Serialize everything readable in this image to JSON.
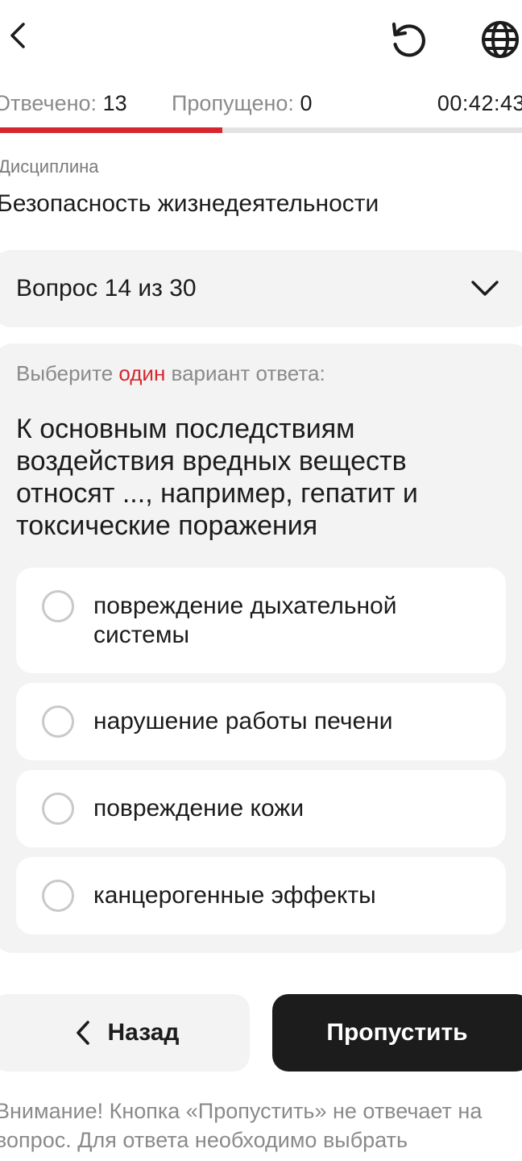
{
  "header": {
    "back_icon": "chevron-left-icon",
    "reset_icon": "reset-icon",
    "language_icon": "globe-icon"
  },
  "stats": {
    "answered_label": "Отвечено:",
    "answered_value": "13",
    "skipped_label": "Пропущено:",
    "skipped_value": "0",
    "timer": "00:42:43"
  },
  "progress": {
    "fraction": 0.4255,
    "fill_color": "#d6262e",
    "track_color": "#e5e2e5"
  },
  "discipline": {
    "label": "Дисциплина",
    "value": "Безопасность жизнедеятельности"
  },
  "question_selector": {
    "label": "Вопрос 14 из 30",
    "icon": "chevron-down-icon"
  },
  "question": {
    "instruction_prefix": "Выберите ",
    "instruction_accent": "один",
    "instruction_suffix": " вариант ответа:",
    "text": "К основным последствиям воздействия вредных веществ относят ..., например, гепатит и токсические поражения",
    "options": [
      {
        "label": "повреждение дыхательной системы"
      },
      {
        "label": "нарушение работы печени"
      },
      {
        "label": "повреждение кожи"
      },
      {
        "label": "канцерогенные эффекты"
      }
    ]
  },
  "navigation": {
    "back_label": "Назад",
    "skip_label": "Пропустить"
  },
  "warning": "Внимание! Кнопка «Пропустить» не отвечает на вопрос. Для ответа необходимо выбрать",
  "colors": {
    "accent": "#d6262e",
    "primary_button": "#1c1c1c",
    "surface": "#f3f3f3"
  }
}
